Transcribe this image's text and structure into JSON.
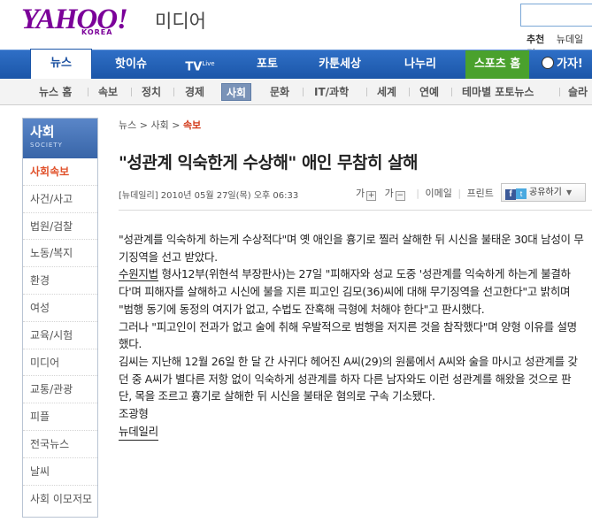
{
  "header": {
    "logo_text": "YAHOO!",
    "logo_sub": "KOREA",
    "site_name": "미디어",
    "top_links": [
      "추천",
      "뉴데일리"
    ]
  },
  "gnb": [
    {
      "label": "뉴스",
      "active": true
    },
    {
      "label": "핫이슈"
    },
    {
      "label": "TV",
      "sup": "Live"
    },
    {
      "label": "포토"
    },
    {
      "label": "카툰세상"
    },
    {
      "label": "나누리"
    },
    {
      "label": "스포츠 홈"
    },
    {
      "label": "가자!"
    }
  ],
  "lnb": [
    {
      "label": "뉴스 홈"
    },
    {
      "label": "속보"
    },
    {
      "label": "정치"
    },
    {
      "label": "경제"
    },
    {
      "label": "사회",
      "active": true
    },
    {
      "label": "문화"
    },
    {
      "label": "IT/과학"
    },
    {
      "label": "세계"
    },
    {
      "label": "연예"
    },
    {
      "label": "테마별 포토뉴스"
    },
    {
      "label": "슬라"
    }
  ],
  "sidebar": {
    "title": "사회",
    "subtitle": "SOCIETY",
    "items": [
      {
        "label": "사회속보",
        "active": true
      },
      {
        "label": "사건/사고"
      },
      {
        "label": "법원/검찰"
      },
      {
        "label": "노동/복지"
      },
      {
        "label": "환경"
      },
      {
        "label": "여성"
      },
      {
        "label": "교육/시험"
      },
      {
        "label": "미디어"
      },
      {
        "label": "교통/관광"
      },
      {
        "label": "피플"
      },
      {
        "label": "전국뉴스"
      },
      {
        "label": "날씨"
      },
      {
        "label": "사회 이모저모"
      }
    ]
  },
  "article": {
    "breadcrumb": [
      "뉴스",
      "사회",
      "속보"
    ],
    "breadcrumb_sep": ">",
    "title": "\"성관계 익숙한게 수상해\" 애인 무참히 살해",
    "meta": "[뉴데일리] 2010년 05월 27일(목) 오후 06:33",
    "font_larger": "가",
    "font_smaller": "가",
    "email": "이메일",
    "print": "프린트",
    "share": "공유하기",
    "paragraphs": [
      "\"성관계를 익숙하게 하는게 수상적다\"며 옛 애인을 흉기로 찔러 살해한 뒤 시신을 불태운 30대 남성이 무기징역을 선고 받았다.",
      "형사12부(위현석 부장판사)는 27일 \"피해자와 성교 도중 '성관계를 익숙하게 하는게 불결하다'며 피해자를 살해하고 시신에 불을 지른 피고인 김모(36)씨에 대해 무기징역을 선고한다\"고 밝히며 \"범행 동기에 동정의 여지가 없고, 수법도 잔혹해 극형에 처해야 한다\"고 판시했다.",
      "그러나 \"피고인이 전과가 없고 술에 취해 우발적으로 범행을 저지른 것을 참작했다\"며 양형 이유를 설명했다.",
      "김씨는 지난해 12월 26일 한 달 간 사귀다 헤어진 A씨(29)의 원룸에서 A씨와 술을 마시고 성관계를 갖던 중 A씨가 별다른 저항 없이 익숙하게 성관계를 하자 다른 남자와도 이런 성관계를 해왔을 것으로 판단, 목을 조르고 흉기로 살해한 뒤 시신을 불태운 혐의로 구속 기소됐다."
    ],
    "court": "수원지법",
    "author": "조광형",
    "source": "뉴데일리"
  }
}
